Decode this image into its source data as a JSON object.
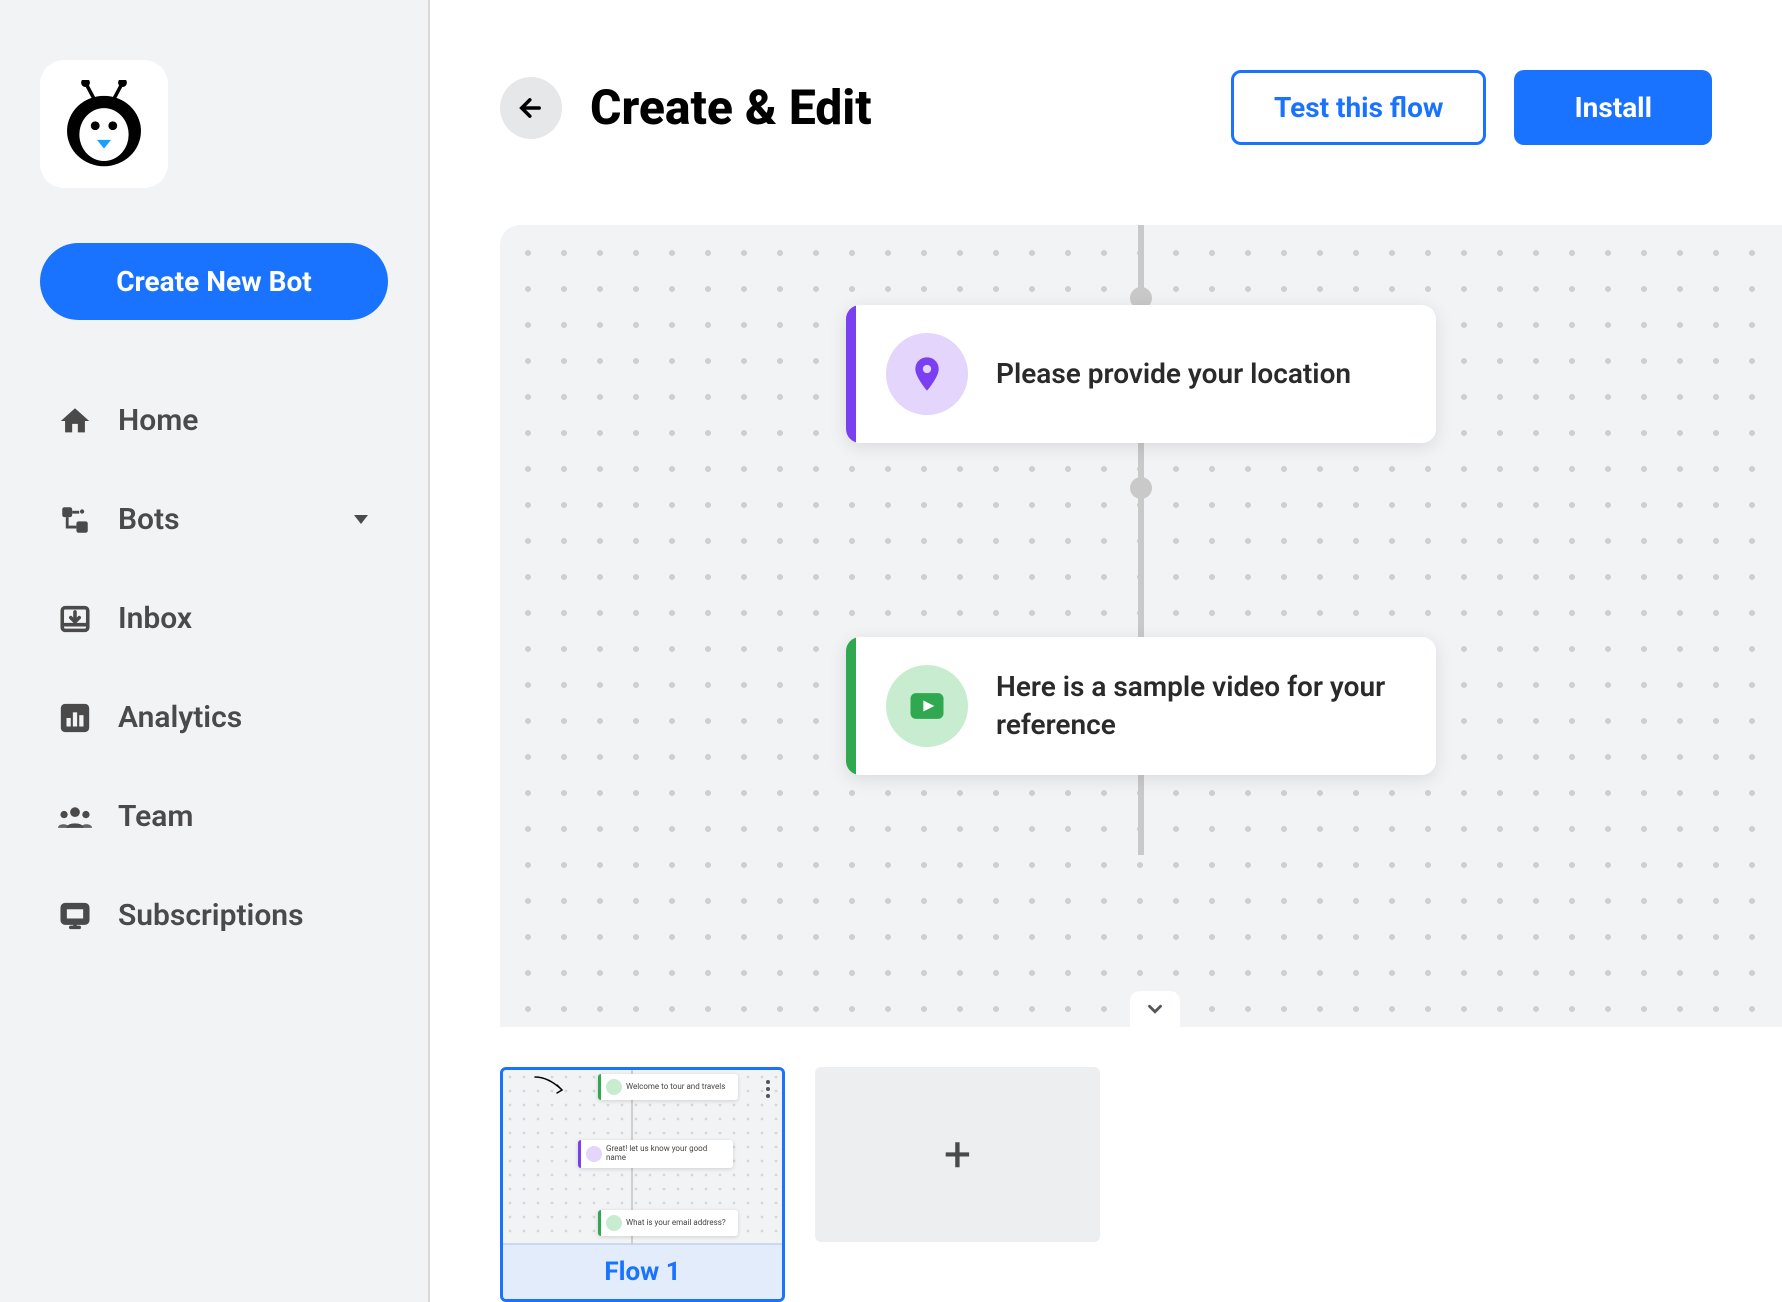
{
  "sidebar": {
    "create_button": "Create New Bot",
    "items": [
      {
        "label": "Home",
        "icon": "home"
      },
      {
        "label": "Bots",
        "icon": "bots",
        "has_caret": true
      },
      {
        "label": "Inbox",
        "icon": "inbox"
      },
      {
        "label": "Analytics",
        "icon": "analytics"
      },
      {
        "label": "Team",
        "icon": "team"
      },
      {
        "label": "Subscriptions",
        "icon": "subscriptions"
      }
    ]
  },
  "header": {
    "title": "Create & Edit",
    "test_button": "Test this flow",
    "install_button": "Install"
  },
  "canvas": {
    "cards": [
      {
        "text": "Please provide your location",
        "accent_color": "#7b3ff2",
        "icon_bg": "#e3d5fb",
        "icon": "location"
      },
      {
        "text": "Here is a sample video for your reference",
        "accent_color": "#2fa84f",
        "icon_bg": "#c8eccf",
        "icon": "video"
      }
    ]
  },
  "tray": {
    "thumb_label": "Flow 1",
    "mini_cards": [
      {
        "text": "Welcome to tour and travels",
        "accent": "#2fa84f",
        "icon_bg": "#c8eccf"
      },
      {
        "text": "Great! let us know your good name",
        "accent": "#7b3ff2",
        "icon_bg": "#e3d5fb"
      },
      {
        "text": "What is your email address?",
        "accent": "#2fa84f",
        "icon_bg": "#c8eccf"
      }
    ]
  }
}
